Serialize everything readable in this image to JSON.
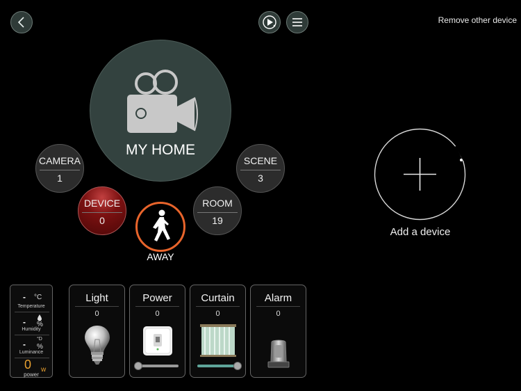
{
  "header": {
    "back_icon": "chevron-left-icon",
    "play_icon": "play-icon",
    "menu_icon": "menu-icon",
    "remove_label": "Remove other device"
  },
  "home": {
    "icon": "video-camera-icon",
    "label": "MY HOME"
  },
  "nav": {
    "camera": {
      "label": "CAMERA",
      "count": "1"
    },
    "scene": {
      "label": "SCENE",
      "count": "3"
    },
    "device": {
      "label": "DEVICE",
      "count": "0"
    },
    "room": {
      "label": "ROOM",
      "count": "19"
    },
    "away": {
      "label": "AWAY",
      "icon": "walking-person-icon"
    }
  },
  "add_device": {
    "icon": "plus-icon",
    "label": "Add a device"
  },
  "environment": {
    "temperature": {
      "value": "-",
      "unit": "°C",
      "label": "Temperature"
    },
    "humidity": {
      "value": "-",
      "unit": "%",
      "label": "Humidity"
    },
    "luminance": {
      "value": "-",
      "unit_top": "°D",
      "unit": "%",
      "label": "Luminance"
    },
    "power": {
      "value": "0",
      "unit": "w",
      "label": "power"
    }
  },
  "device_cards": [
    {
      "title": "Light",
      "count": "0",
      "icon": "light-bulb-icon"
    },
    {
      "title": "Power",
      "count": "0",
      "icon": "power-socket-icon",
      "slider_level": 0
    },
    {
      "title": "Curtain",
      "count": "0",
      "icon": "curtain-icon",
      "slider_level": 1
    },
    {
      "title": "Alarm",
      "count": "0",
      "icon": "alarm-siren-icon"
    }
  ],
  "colors": {
    "accent_teal": "#33423f",
    "away_ring": "#e8642b",
    "device_red": "#7b1111",
    "power_value": "#e8a030"
  }
}
